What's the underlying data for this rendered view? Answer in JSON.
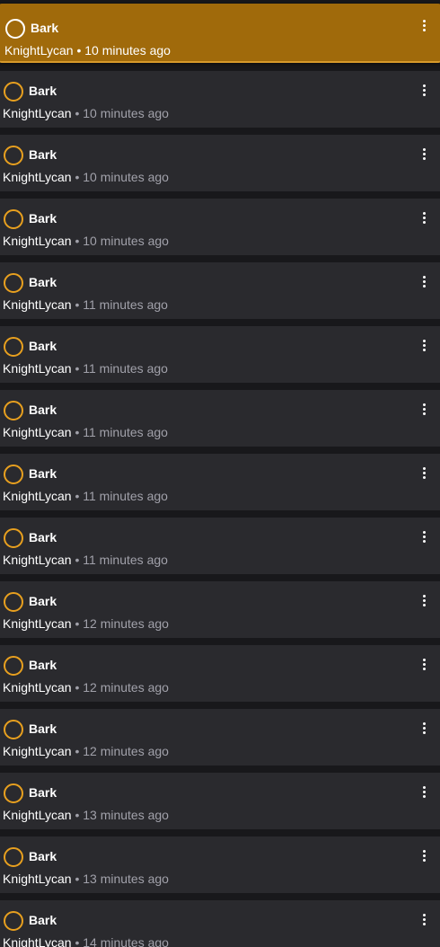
{
  "icon": "loading-spinner-icon",
  "accent_color": "#e8a01f",
  "selected_bg": "#a06a0b",
  "separator": "•",
  "items": [
    {
      "title": "Bark",
      "author": "KnightLycan",
      "time": "10 minutes ago",
      "selected": true
    },
    {
      "title": "Bark",
      "author": "KnightLycan",
      "time": "10 minutes ago"
    },
    {
      "title": "Bark",
      "author": "KnightLycan",
      "time": "10 minutes ago"
    },
    {
      "title": "Bark",
      "author": "KnightLycan",
      "time": "10 minutes ago"
    },
    {
      "title": "Bark",
      "author": "KnightLycan",
      "time": "11 minutes ago"
    },
    {
      "title": "Bark",
      "author": "KnightLycan",
      "time": "11 minutes ago"
    },
    {
      "title": "Bark",
      "author": "KnightLycan",
      "time": "11 minutes ago"
    },
    {
      "title": "Bark",
      "author": "KnightLycan",
      "time": "11 minutes ago"
    },
    {
      "title": "Bark",
      "author": "KnightLycan",
      "time": "11 minutes ago"
    },
    {
      "title": "Bark",
      "author": "KnightLycan",
      "time": "12 minutes ago"
    },
    {
      "title": "Bark",
      "author": "KnightLycan",
      "time": "12 minutes ago"
    },
    {
      "title": "Bark",
      "author": "KnightLycan",
      "time": "12 minutes ago"
    },
    {
      "title": "Bark",
      "author": "KnightLycan",
      "time": "13 minutes ago"
    },
    {
      "title": "Bark",
      "author": "KnightLycan",
      "time": "13 minutes ago"
    },
    {
      "title": "Bark",
      "author": "KnightLycan",
      "time": "14 minutes ago"
    }
  ]
}
